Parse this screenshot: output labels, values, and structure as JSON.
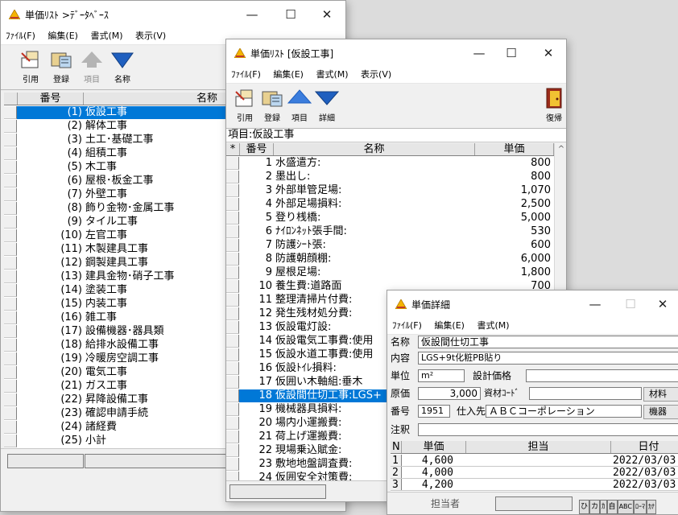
{
  "colors": {
    "selection": "#0078d7",
    "up_arrow": "#3b7ddd",
    "down_arrow": "#1f5fbf"
  },
  "w1": {
    "title": "単価ﾘｽﾄ >ﾃﾞｰﾀﾍﾞｰｽ",
    "menu": [
      "ﾌｧｲﾙ(F)",
      "編集(E)",
      "書式(M)",
      "表示(V)"
    ],
    "toolbar": [
      "引用",
      "登録",
      "項目",
      "名称"
    ],
    "cols": [
      "番号",
      "名称"
    ],
    "rows": [
      {
        "no": "(1)",
        "name": "仮設工事"
      },
      {
        "no": "(2)",
        "name": "解体工事"
      },
      {
        "no": "(3)",
        "name": "土工･基礎工事"
      },
      {
        "no": "(4)",
        "name": "組積工事"
      },
      {
        "no": "(5)",
        "name": "木工事"
      },
      {
        "no": "(6)",
        "name": "屋根･板金工事"
      },
      {
        "no": "(7)",
        "name": "外壁工事"
      },
      {
        "no": "(8)",
        "name": "飾り金物･金属工事"
      },
      {
        "no": "(9)",
        "name": "タイル工事"
      },
      {
        "no": "(10)",
        "name": "左官工事"
      },
      {
        "no": "(11)",
        "name": "木製建具工事"
      },
      {
        "no": "(12)",
        "name": "鋼製建具工事"
      },
      {
        "no": "(13)",
        "name": "建具金物･硝子工事"
      },
      {
        "no": "(14)",
        "name": "塗装工事"
      },
      {
        "no": "(15)",
        "name": "内装工事"
      },
      {
        "no": "(16)",
        "name": "雑工事"
      },
      {
        "no": "(17)",
        "name": "設備機器･器具類"
      },
      {
        "no": "(18)",
        "name": "給排水設備工事"
      },
      {
        "no": "(19)",
        "name": "冷暖房空調工事"
      },
      {
        "no": "(20)",
        "name": "電気工事"
      },
      {
        "no": "(21)",
        "name": "ガス工事"
      },
      {
        "no": "(22)",
        "name": "昇降設備工事"
      },
      {
        "no": "(23)",
        "name": "確認申請手続"
      },
      {
        "no": "(24)",
        "name": "諸経費"
      },
      {
        "no": "(25)",
        "name": "小計"
      }
    ]
  },
  "w2": {
    "title": "単価ﾘｽﾄ [仮設工事]",
    "menu": [
      "ﾌｧｲﾙ(F)",
      "編集(E)",
      "書式(M)",
      "表示(V)"
    ],
    "toolbar": [
      "引用",
      "登録",
      "項目",
      "詳細"
    ],
    "toolbar_right": "復帰",
    "item_label": "項目:仮設工事",
    "cols": [
      "*",
      "番号",
      "名称",
      "単価"
    ],
    "rows": [
      {
        "no": "1",
        "name": "水盛遣方:",
        "price": "800"
      },
      {
        "no": "2",
        "name": "墨出し:",
        "price": "800"
      },
      {
        "no": "3",
        "name": "外部単管足場:",
        "price": "1,070"
      },
      {
        "no": "4",
        "name": "外部足場損料:",
        "price": "2,500"
      },
      {
        "no": "5",
        "name": "登り桟橋:",
        "price": "5,000"
      },
      {
        "no": "6",
        "name": "ﾅｲﾛﾝﾈｯﾄ張手間:",
        "price": "530"
      },
      {
        "no": "7",
        "name": "防護ｼｰﾄ張:",
        "price": "600"
      },
      {
        "no": "8",
        "name": "防護朝顔棚:",
        "price": "6,000"
      },
      {
        "no": "9",
        "name": "屋根足場:",
        "price": "1,800"
      },
      {
        "no": "10",
        "name": "養生費:道路面",
        "price": "700"
      },
      {
        "no": "11",
        "name": "整理清掃片付費:",
        "price": ""
      },
      {
        "no": "12",
        "name": "発生残材処分費:",
        "price": ""
      },
      {
        "no": "13",
        "name": "仮設電灯設:",
        "price": ""
      },
      {
        "no": "14",
        "name": "仮設電気工事費:使用",
        "price": ""
      },
      {
        "no": "15",
        "name": "仮設水道工事費:使用",
        "price": ""
      },
      {
        "no": "16",
        "name": "仮設ﾄｲﾚ損料:",
        "price": ""
      },
      {
        "no": "17",
        "name": "仮囲い木軸組:垂木",
        "price": ""
      },
      {
        "no": "18",
        "name": "仮設間仕切工事:LGS+",
        "price": ""
      },
      {
        "no": "19",
        "name": "機械器具損料:",
        "price": ""
      },
      {
        "no": "20",
        "name": "場内小運搬費:",
        "price": ""
      },
      {
        "no": "21",
        "name": "荷上げ運搬費:",
        "price": ""
      },
      {
        "no": "22",
        "name": "現場乗込賦金:",
        "price": ""
      },
      {
        "no": "23",
        "name": "敷地地盤調査費:",
        "price": ""
      },
      {
        "no": "24",
        "name": "仮囲安全対策費:",
        "price": ""
      }
    ]
  },
  "w3": {
    "title": "単価詳細",
    "menu": [
      "ﾌｧｲﾙ(F)",
      "編集(E)",
      "書式(M)"
    ],
    "labels": {
      "name": "名称",
      "content": "内容",
      "unit": "単位",
      "design_price": "設計価格",
      "cost": "原価",
      "material_code": "資材ｺｰﾄﾞ",
      "number": "番号",
      "supplier": "仕入先",
      "note": "注釈",
      "assignee_status": "担当者"
    },
    "values": {
      "name": "仮設間仕切工事",
      "content": "LGS+9t化粧PB貼り",
      "unit": "m²",
      "cost": "3,000",
      "number": "1951",
      "supplier": "ＡＢＣコーポレーション"
    },
    "buttons": {
      "material": "材料",
      "equipment": "機器"
    },
    "cols": [
      "N",
      "単価",
      "担当",
      "日付"
    ],
    "rows": [
      {
        "n": "1",
        "price": "4,600",
        "assignee": "",
        "date": "2022/03/03"
      },
      {
        "n": "2",
        "price": "4,000",
        "assignee": "",
        "date": "2022/03/03"
      },
      {
        "n": "3",
        "price": "4,200",
        "assignee": "",
        "date": "2022/03/03"
      }
    ],
    "ime": [
      "ひ",
      "カ",
      "ｶ",
      "自",
      "ABC",
      "ﾛｰﾏ",
      "ｶﾅ"
    ]
  }
}
